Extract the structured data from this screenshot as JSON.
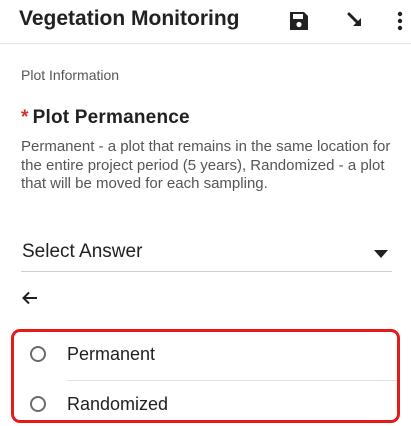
{
  "toolbar": {
    "title": "Vegetation Monitoring",
    "icons": [
      "save-icon",
      "download-arrow-icon",
      "more-vertical-icon"
    ]
  },
  "form": {
    "section_label": "Plot Information",
    "question": {
      "required_marker": "*",
      "title": "Plot Permanence",
      "description": "Permanent - a plot that remains in the same location for the entire project period (5 years), Randomized - a plot that will be moved for each sampling."
    },
    "select": {
      "value": "Select Answer"
    },
    "back_icon": "back-arrow-icon",
    "options": [
      {
        "label": "Permanent",
        "selected": false
      },
      {
        "label": "Randomized",
        "selected": false
      }
    ]
  },
  "colors": {
    "required": "#d32f2f",
    "highlight_frame": "#e61a1a"
  }
}
